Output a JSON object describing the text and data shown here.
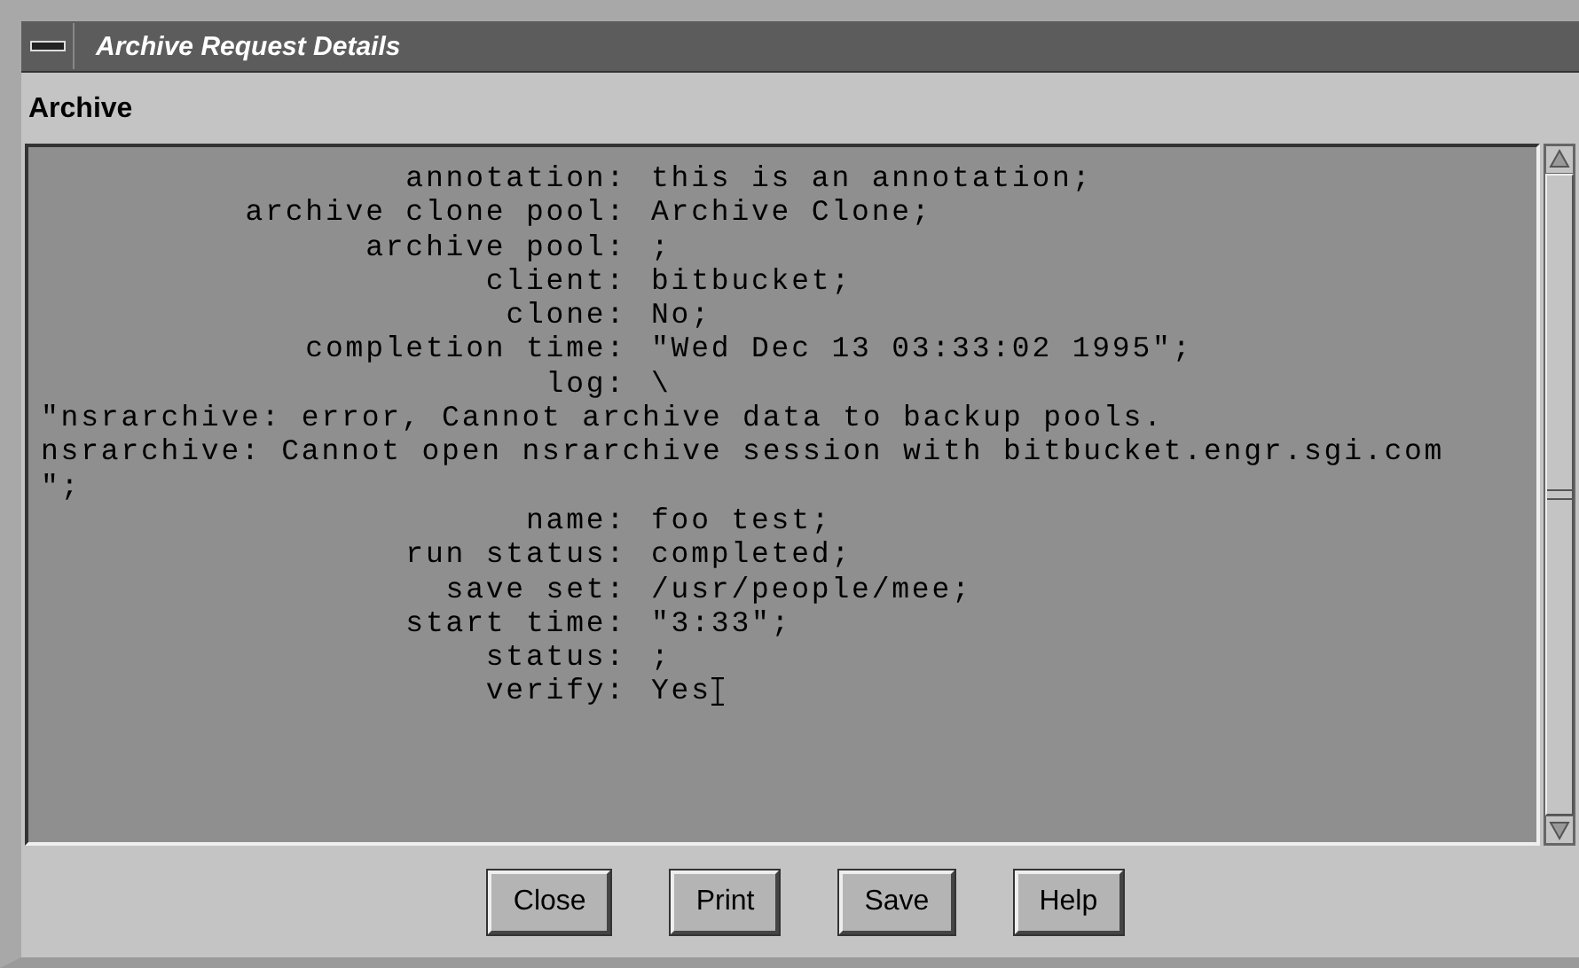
{
  "window": {
    "title": "Archive Request Details"
  },
  "section_label": "Archive",
  "details": [
    {
      "kind": "field",
      "label": "annotation:",
      "value": "this is an annotation;"
    },
    {
      "kind": "field",
      "label": "archive clone pool:",
      "value": "Archive Clone;"
    },
    {
      "kind": "field",
      "label": "archive pool:",
      "value": ";"
    },
    {
      "kind": "field",
      "label": "client:",
      "value": "bitbucket;"
    },
    {
      "kind": "field",
      "label": "clone:",
      "value": "No;"
    },
    {
      "kind": "field",
      "label": "completion time:",
      "value": "\"Wed Dec 13 03:33:02 1995\";"
    },
    {
      "kind": "field",
      "label": "log:",
      "value": "\\"
    },
    {
      "kind": "text",
      "value": "\"nsrarchive: error, Cannot archive data to backup pools."
    },
    {
      "kind": "text",
      "value": "nsrarchive: Cannot open nsrarchive session with bitbucket.engr.sgi.com"
    },
    {
      "kind": "text",
      "value": "\";"
    },
    {
      "kind": "field",
      "label": "name:",
      "value": "foo test;"
    },
    {
      "kind": "field",
      "label": "run status:",
      "value": "completed;"
    },
    {
      "kind": "field",
      "label": "save set:",
      "value": "/usr/people/mee;"
    },
    {
      "kind": "field",
      "label": "start time:",
      "value": "\"3:33\";"
    },
    {
      "kind": "field",
      "label": "status:",
      "value": ";"
    },
    {
      "kind": "field",
      "label": "verify:",
      "value": "Yes",
      "cursor": true
    }
  ],
  "buttons": [
    "Close",
    "Print",
    "Save",
    "Help"
  ]
}
